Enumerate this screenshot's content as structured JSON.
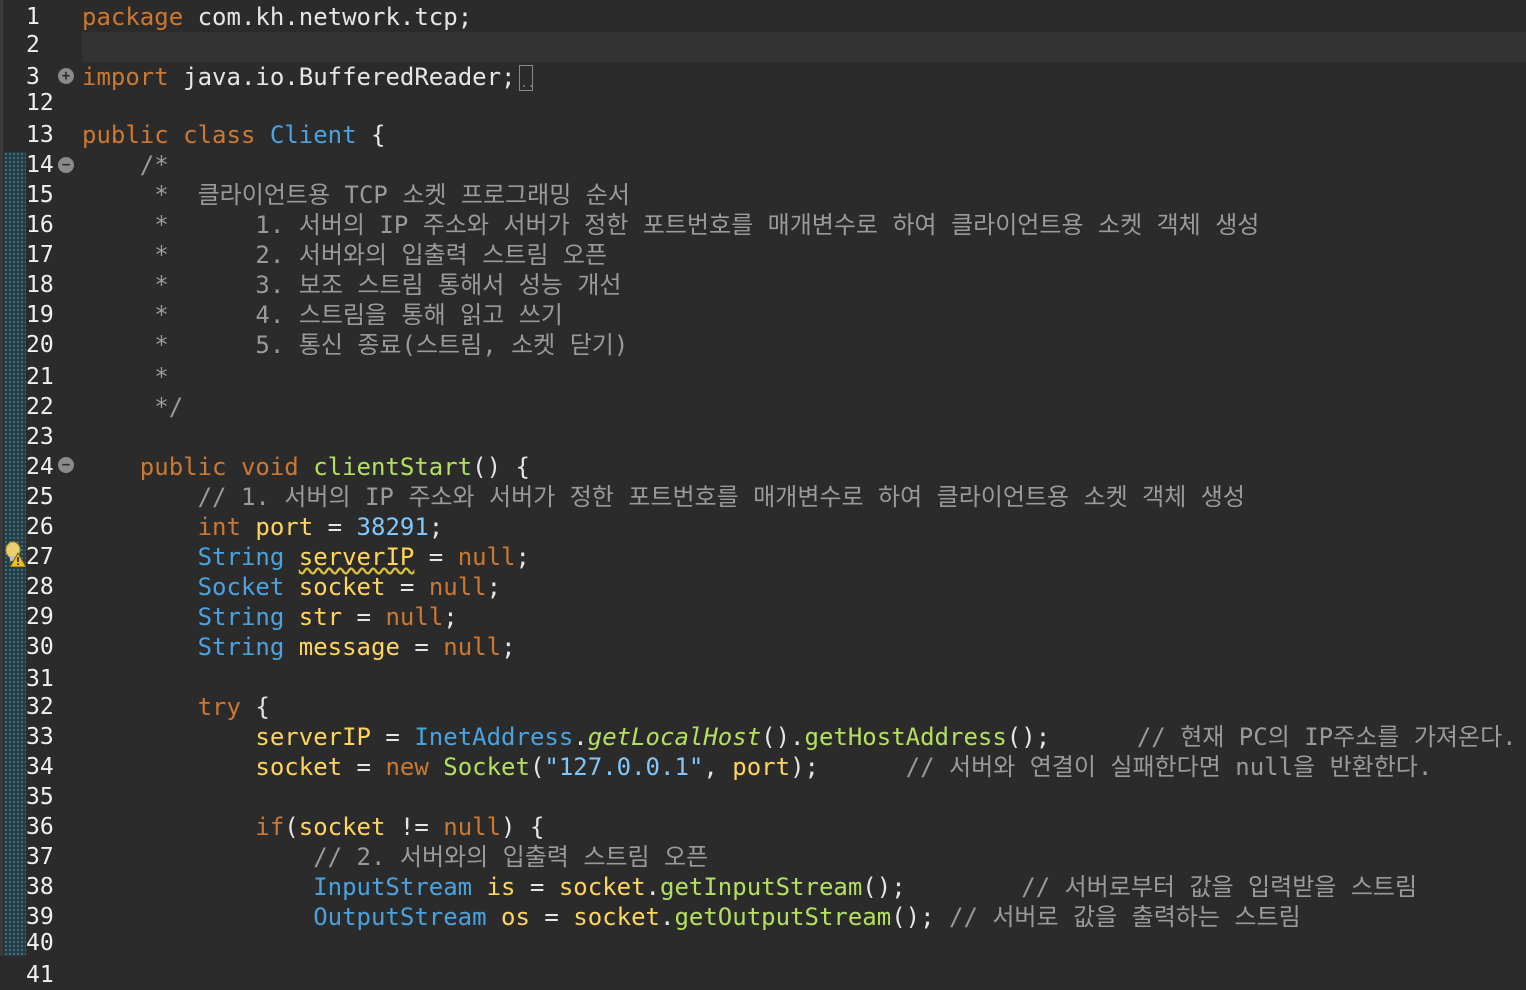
{
  "editor": {
    "lines": [
      {
        "n": "1",
        "segs": [
          [
            "kw",
            "package"
          ],
          [
            "pl",
            " com.kh.network.tcp;"
          ]
        ]
      },
      {
        "n": "2",
        "segs": []
      },
      {
        "n": "3",
        "segs": [
          [
            "kw",
            "import"
          ],
          [
            "pl",
            " java.io.BufferedReader;"
          ]
        ]
      },
      {
        "n": "12",
        "segs": []
      },
      {
        "n": "13",
        "segs": [
          [
            "kw",
            "public class "
          ],
          [
            "ty",
            "Client"
          ],
          [
            "pl",
            " {"
          ]
        ]
      },
      {
        "n": "14",
        "segs": [
          [
            "cm",
            "    /*"
          ]
        ]
      },
      {
        "n": "15",
        "segs": [
          [
            "cm",
            "     *  클라이언트용 TCP 소켓 프로그래밍 순서"
          ]
        ]
      },
      {
        "n": "16",
        "segs": [
          [
            "cm",
            "     *      1. 서버의 IP 주소와 서버가 정한 포트번호를 매개변수로 하여 클라이언트용 소켓 객체 생성"
          ]
        ]
      },
      {
        "n": "17",
        "segs": [
          [
            "cm",
            "     *      2. 서버와의 입출력 스트림 오픈"
          ]
        ]
      },
      {
        "n": "18",
        "segs": [
          [
            "cm",
            "     *      3. 보조 스트림 통해서 성능 개선"
          ]
        ]
      },
      {
        "n": "19",
        "segs": [
          [
            "cm",
            "     *      4. 스트림을 통해 읽고 쓰기"
          ]
        ]
      },
      {
        "n": "20",
        "segs": [
          [
            "cm",
            "     *      5. 통신 종료(스트림, 소켓 닫기)"
          ]
        ]
      },
      {
        "n": "21",
        "segs": [
          [
            "cm",
            "     *"
          ]
        ]
      },
      {
        "n": "22",
        "segs": [
          [
            "cm",
            "     */"
          ]
        ]
      },
      {
        "n": "23",
        "segs": []
      },
      {
        "n": "24",
        "segs": [
          [
            "kw",
            "    public void "
          ],
          [
            "fn",
            "clientStart"
          ],
          [
            "pl",
            "() {"
          ]
        ]
      },
      {
        "n": "25",
        "segs": [
          [
            "cm",
            "        // 1. 서버의 IP 주소와 서버가 정한 포트번호를 매개변수로 하여 클라이언트용 소켓 객체 생성"
          ]
        ]
      },
      {
        "n": "26",
        "segs": [
          [
            "kw",
            "        int "
          ],
          [
            "nm",
            "port"
          ],
          [
            "pl",
            " = "
          ],
          [
            "num",
            "38291"
          ],
          [
            "pl",
            ";"
          ]
        ]
      },
      {
        "n": "27",
        "segs": [
          [
            "ty",
            "        String "
          ],
          [
            "nmw",
            "serverIP"
          ],
          [
            "pl",
            " = "
          ],
          [
            "kw",
            "null"
          ],
          [
            "pl",
            ";"
          ]
        ]
      },
      {
        "n": "28",
        "segs": [
          [
            "ty",
            "        Socket "
          ],
          [
            "nm",
            "socket"
          ],
          [
            "pl",
            " = "
          ],
          [
            "kw",
            "null"
          ],
          [
            "pl",
            ";"
          ]
        ]
      },
      {
        "n": "29",
        "segs": [
          [
            "ty",
            "        String "
          ],
          [
            "nm",
            "str"
          ],
          [
            "pl",
            " = "
          ],
          [
            "kw",
            "null"
          ],
          [
            "pl",
            ";"
          ]
        ]
      },
      {
        "n": "30",
        "segs": [
          [
            "ty",
            "        String "
          ],
          [
            "nm",
            "message"
          ],
          [
            "pl",
            " = "
          ],
          [
            "kw",
            "null"
          ],
          [
            "pl",
            ";"
          ]
        ]
      },
      {
        "n": "31",
        "segs": []
      },
      {
        "n": "32",
        "segs": [
          [
            "kw",
            "        try"
          ],
          [
            "pl",
            " {"
          ]
        ]
      },
      {
        "n": "33",
        "segs": [
          [
            "nm",
            "            serverIP"
          ],
          [
            "pl",
            " = "
          ],
          [
            "ty",
            "InetAddress"
          ],
          [
            "pl",
            "."
          ],
          [
            "mt",
            "getLocalHost"
          ],
          [
            "pl",
            "()."
          ],
          [
            "fn",
            "getHostAddress"
          ],
          [
            "pl",
            "();"
          ],
          [
            "cm",
            "      // 현재 PC의 IP주소를 가져온다."
          ]
        ]
      },
      {
        "n": "34",
        "segs": [
          [
            "nm",
            "            socket"
          ],
          [
            "pl",
            " = "
          ],
          [
            "kw",
            "new "
          ],
          [
            "fn",
            "Socket"
          ],
          [
            "pl",
            "("
          ],
          [
            "str",
            "\"127.0.0.1\""
          ],
          [
            "pl",
            ", "
          ],
          [
            "nm",
            "port"
          ],
          [
            "pl",
            ");"
          ],
          [
            "cm",
            "      // 서버와 연결이 실패한다면 null을 반환한다."
          ]
        ]
      },
      {
        "n": "35",
        "segs": []
      },
      {
        "n": "36",
        "segs": [
          [
            "kw",
            "            if"
          ],
          [
            "pl",
            "("
          ],
          [
            "nm",
            "socket"
          ],
          [
            "pl",
            " != "
          ],
          [
            "kw",
            "null"
          ],
          [
            "pl",
            ") {"
          ]
        ]
      },
      {
        "n": "37",
        "segs": [
          [
            "cm",
            "                // 2. 서버와의 입출력 스트림 오픈"
          ]
        ]
      },
      {
        "n": "38",
        "segs": [
          [
            "ty",
            "                InputStream "
          ],
          [
            "nm",
            "is"
          ],
          [
            "pl",
            " = "
          ],
          [
            "nm",
            "socket"
          ],
          [
            "pl",
            "."
          ],
          [
            "fn",
            "getInputStream"
          ],
          [
            "pl",
            "();"
          ],
          [
            "cm",
            "        // 서버로부터 값을 입력받을 스트림"
          ]
        ]
      },
      {
        "n": "39",
        "segs": [
          [
            "ty",
            "                OutputStream "
          ],
          [
            "nm",
            "os"
          ],
          [
            "pl",
            " = "
          ],
          [
            "nm",
            "socket"
          ],
          [
            "pl",
            "."
          ],
          [
            "fn",
            "getOutputStream"
          ],
          [
            "pl",
            "(); "
          ],
          [
            "cm",
            "// 서버로 값을 출력하는 스트림"
          ]
        ]
      },
      {
        "n": "40",
        "segs": []
      },
      {
        "n": "41",
        "segs": []
      }
    ]
  }
}
